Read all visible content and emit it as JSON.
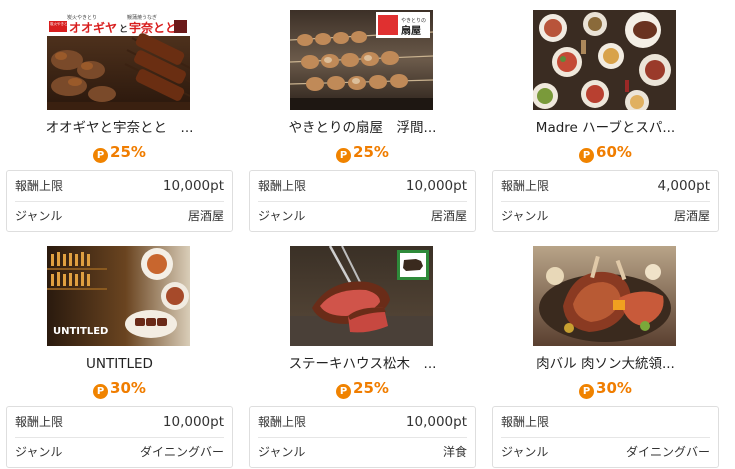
{
  "labels": {
    "reward_limit": "報酬上限",
    "genre": "ジャンル",
    "point_icon": "P"
  },
  "cards": [
    {
      "name": "オオギヤと宇奈とと　...",
      "rate": "25%",
      "reward": "10,000pt",
      "genre": "居酒屋",
      "image": {
        "kind": "grilled-skewers-photo",
        "logo_small_1": "炭火やきとり",
        "logo_small_2": "鰻蒲焼うなぎ",
        "logo_small_3": "炭火やきとり",
        "logo_brand_1": "オオギヤ",
        "logo_and": "と",
        "logo_brand_2": "宇奈とと"
      }
    },
    {
      "name": "やきとりの扇屋　浮間...",
      "rate": "25%",
      "reward": "10,000pt",
      "genre": "居酒屋",
      "image": {
        "kind": "yakitori-skewers-photo",
        "logo_small": "やきとりの",
        "logo_brand": "扇屋"
      }
    },
    {
      "name": "Madre ハーブとスパ...",
      "rate": "60%",
      "reward": "4,000pt",
      "genre": "居酒屋",
      "image": {
        "kind": "table-spread-photo"
      }
    },
    {
      "name": "UNTITLED",
      "rate": "30%",
      "reward": "10,000pt",
      "genre": "ダイニングバー",
      "image": {
        "kind": "bar-interior-photo",
        "logo_text": "UNTITLED"
      }
    },
    {
      "name": "ステーキハウス松木　...",
      "rate": "25%",
      "reward": "10,000pt",
      "genre": "洋食",
      "image": {
        "kind": "steak-photo"
      }
    },
    {
      "name": "肉バル 肉ソン大統領...",
      "rate": "30%",
      "reward": "",
      "genre": "ダイニングバー",
      "image": {
        "kind": "meat-platter-photo"
      }
    }
  ],
  "colors": {
    "accent_orange": "#f07d00",
    "card_border": "#dedede"
  }
}
